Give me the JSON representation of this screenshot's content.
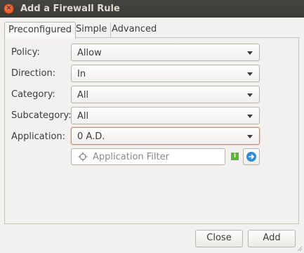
{
  "window": {
    "title": "Add a Firewall Rule"
  },
  "tabs": [
    {
      "label": "Preconfigured",
      "active": true
    },
    {
      "label": "Simple",
      "active": false
    },
    {
      "label": "Advanced",
      "active": false
    }
  ],
  "form": {
    "policy": {
      "label": "Policy:",
      "value": "Allow"
    },
    "direction": {
      "label": "Direction:",
      "value": "In"
    },
    "category": {
      "label": "Category:",
      "value": "All"
    },
    "subcategory": {
      "label": "Subcategory:",
      "value": "All"
    },
    "application": {
      "label": "Application:",
      "value": "0 A.D."
    },
    "filter": {
      "placeholder": "Application Filter",
      "value": ""
    }
  },
  "icons": {
    "close": "close-icon",
    "filter": "crosshair-icon",
    "info": "info-icon",
    "go": "arrow-right-circle-icon"
  },
  "buttons": {
    "close": "Close",
    "add": "Add"
  },
  "colors": {
    "titlebar": "#3a3a37",
    "close_button": "#e4602a",
    "focus_border": "#e0835a",
    "info_green": "#5bb535",
    "go_blue": "#2f8ed6"
  }
}
